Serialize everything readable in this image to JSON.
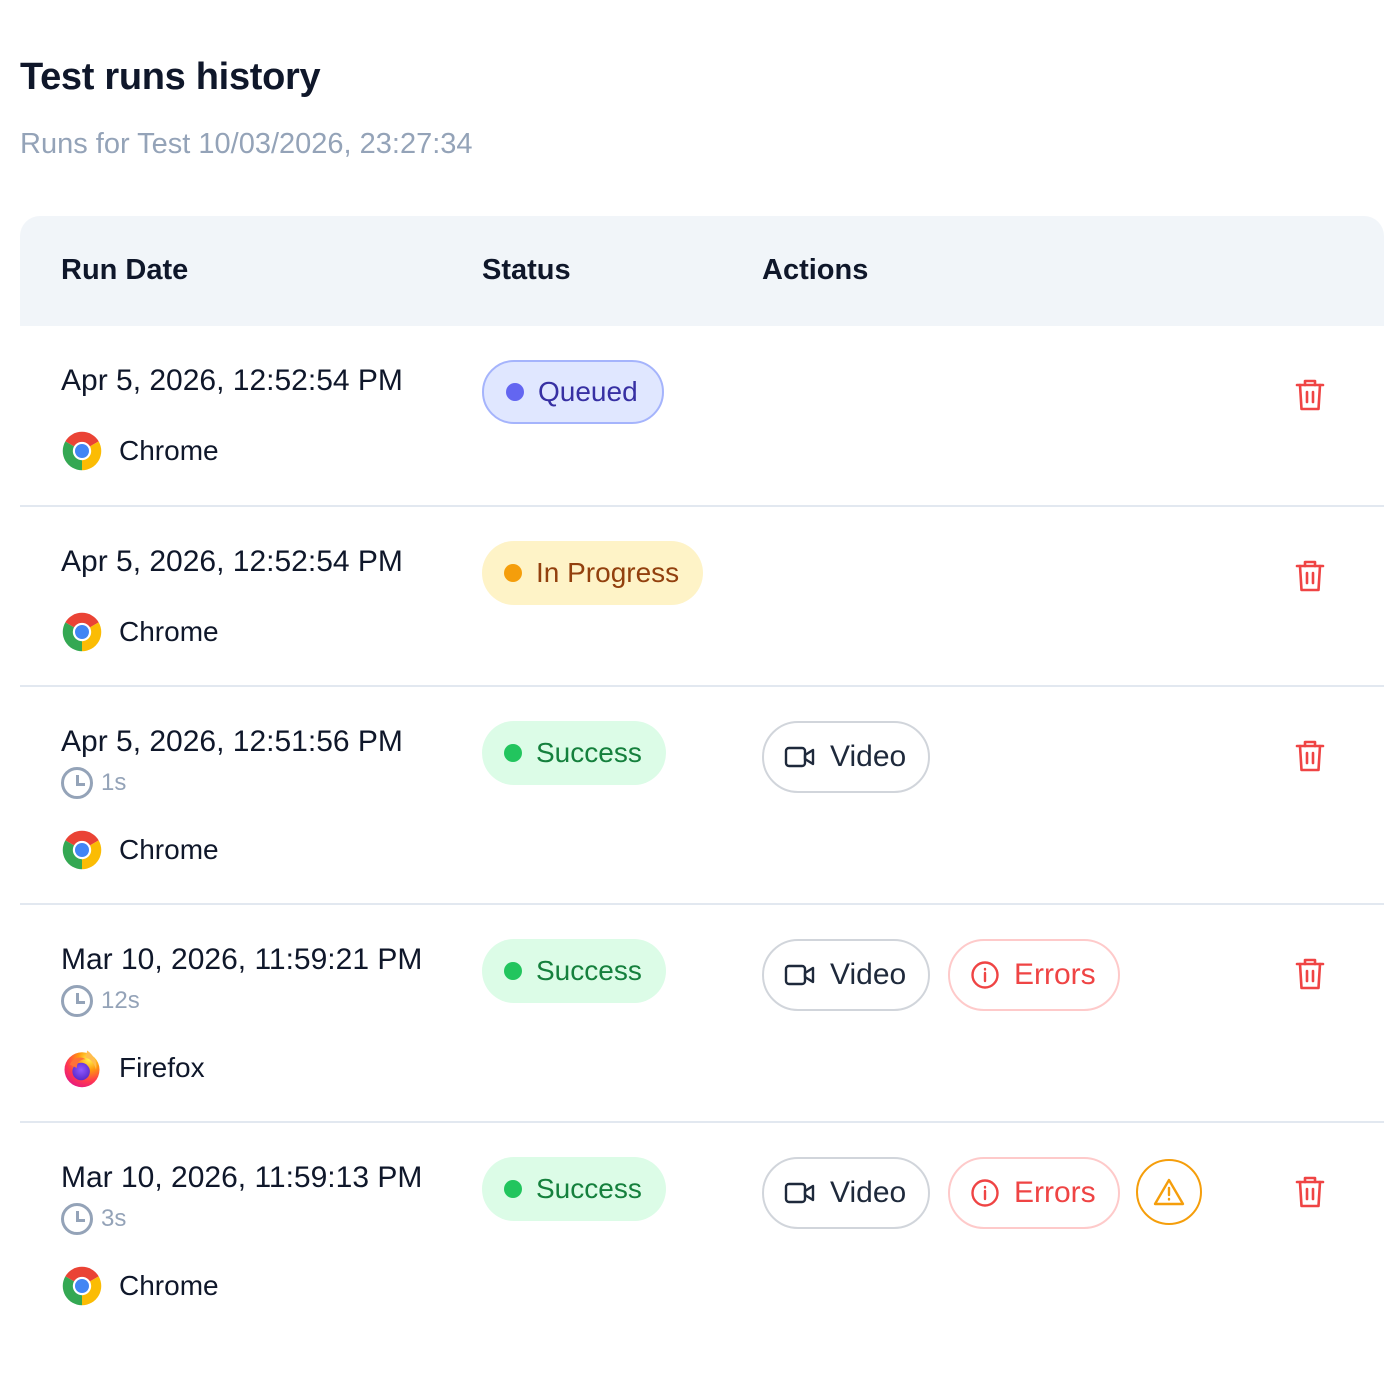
{
  "header": {
    "title": "Test runs history",
    "subtitle": "Runs for Test 10/03/2026, 23:27:34"
  },
  "table": {
    "columns": [
      "Run Date",
      "Status",
      "Actions"
    ]
  },
  "runs": [
    {
      "date": "Apr 5, 2026, 12:52:54 PM",
      "duration": "",
      "browser": "Chrome",
      "browser_icon": "chrome-icon",
      "status": "Queued",
      "actions": []
    },
    {
      "date": "Apr 5, 2026, 12:52:54 PM",
      "duration": "",
      "browser": "Chrome",
      "browser_icon": "chrome-icon",
      "status": "In Progress",
      "actions": []
    },
    {
      "date": "Apr 5, 2026, 12:51:56 PM",
      "duration": "1s",
      "browser": "Chrome",
      "browser_icon": "chrome-icon",
      "status": "Success",
      "actions": [
        "Video"
      ]
    },
    {
      "date": "Mar 10, 2026, 11:59:21 PM",
      "duration": "12s",
      "browser": "Firefox",
      "browser_icon": "firefox-icon",
      "status": "Success",
      "actions": [
        "Video",
        "Errors"
      ]
    },
    {
      "date": "Mar 10, 2026, 11:59:13 PM",
      "duration": "3s",
      "browser": "Chrome",
      "browser_icon": "chrome-icon",
      "status": "Success",
      "actions": [
        "Video",
        "Errors",
        "warning"
      ]
    }
  ],
  "colors": {
    "queued": "#6366f1",
    "in_progress": "#f59e0b",
    "success": "#22c55e",
    "error": "#ef4444",
    "warning": "#f59e0b",
    "delete": "#ef4444"
  }
}
